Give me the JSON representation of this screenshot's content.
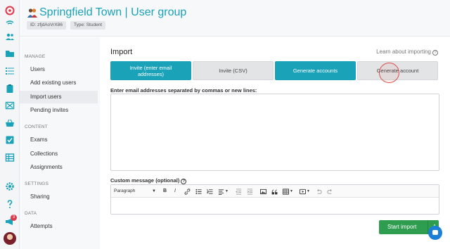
{
  "app": {
    "title": "Springfield Town | User group",
    "chips": {
      "id": "ID: zfjdAoVrX86",
      "type": "Type: Student"
    }
  },
  "rail": {
    "icons": [
      "logo-icon",
      "wifi-icon",
      "users-icon",
      "folder-icon",
      "list-icon",
      "clipboard-icon",
      "media-icon",
      "basket-icon",
      "check-icon",
      "table-icon",
      "gear-icon",
      "help-icon",
      "megaphone-icon"
    ],
    "notifications": "3"
  },
  "sidebar": {
    "manage_label": "MANAGE",
    "manage": [
      "Users",
      "Add existing users",
      "Import users",
      "Pending invites"
    ],
    "content_label": "CONTENT",
    "content": [
      "Exams",
      "Collections",
      "Assignments"
    ],
    "settings_label": "SETTINGS",
    "settings": [
      "Sharing"
    ],
    "data_label": "DATA",
    "data": [
      "Attempts"
    ],
    "active": "Import users"
  },
  "main": {
    "heading": "Import",
    "learn_link": "Learn about importing",
    "tabs": [
      {
        "label": "Invite (enter email addresses)",
        "state": "selected"
      },
      {
        "label": "Invite (CSV)",
        "state": "default"
      },
      {
        "label": "Generate accounts",
        "state": "selected"
      },
      {
        "label": "Generate account",
        "state": "hover"
      }
    ],
    "email_label": "Enter email addresses separated by commas or new lines:",
    "email_value": "",
    "message_label": "Custom message (optional)",
    "editor": {
      "block_format": "Paragraph",
      "body": ""
    },
    "start_button": "Start import"
  },
  "colors": {
    "accent": "#1aa2b8",
    "success": "#2e9d4f",
    "chat": "#1b7fd8",
    "badge": "#e0384b"
  }
}
